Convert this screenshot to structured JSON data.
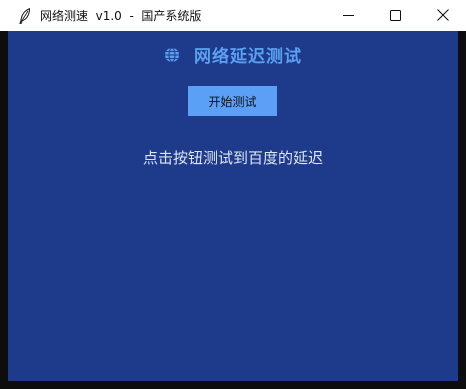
{
  "window": {
    "title": "网络测速  v1.0  -  国产系统版"
  },
  "main": {
    "heading": "网络延迟测试",
    "start_button_label": "开始测试",
    "status_text": "点击按钮测试到百度的延迟"
  },
  "icons": {
    "app": "feather-icon",
    "heading": "globe-icon",
    "minimize": "minimize-icon",
    "maximize": "maximize-icon",
    "close": "close-icon"
  },
  "colors": {
    "background": "#1e3a8a",
    "accent": "#5b9ff7",
    "heading": "#5b9ff0",
    "status_text": "#dde6f5"
  }
}
